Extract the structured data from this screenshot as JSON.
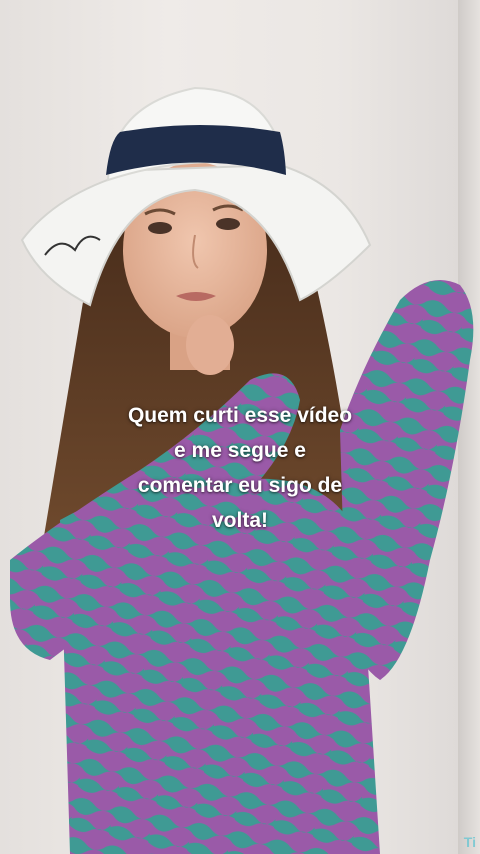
{
  "caption": {
    "lines": [
      "Quem curti esse vídeo",
      "e me segue e",
      "comentar eu sigo de",
      "volta!"
    ]
  },
  "watermark": {
    "text": "Ti"
  },
  "colors": {
    "wall": "#ebe7e4",
    "hat": "#f4f4f2",
    "hat_band": "#1f2d4a",
    "hair": "#5a3a24",
    "dress_purple": "#9a5aa8",
    "dress_teal": "#3f9a94",
    "skin": "#e7b8a0",
    "caption_text": "#ffffff"
  }
}
